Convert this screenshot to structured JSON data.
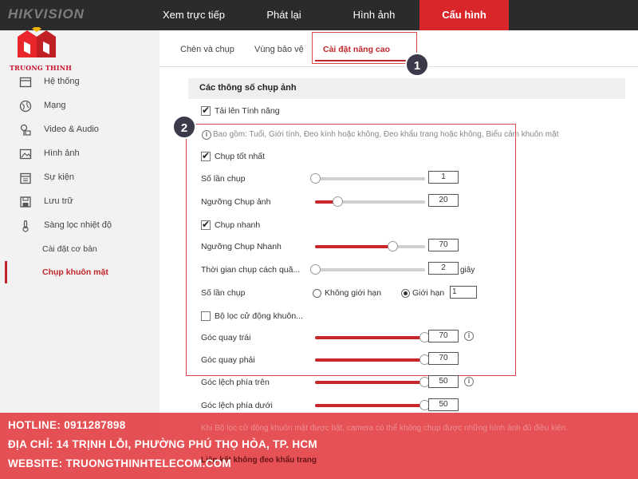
{
  "brand": "HIKVISION",
  "logo_text": "TRUONG THINH",
  "nav": {
    "tabs": [
      {
        "label": "Xem trực tiếp"
      },
      {
        "label": "Phát lại"
      },
      {
        "label": "Hình ảnh"
      },
      {
        "label": "Cấu hình",
        "active": true
      }
    ]
  },
  "sidebar": {
    "items": [
      {
        "label": "Hệ thống",
        "icon": "system-icon"
      },
      {
        "label": "Mạng",
        "icon": "globe-icon"
      },
      {
        "label": "Video & Audio",
        "icon": "video-audio-icon"
      },
      {
        "label": "Hình ảnh",
        "icon": "image-icon"
      },
      {
        "label": "Sự kiện",
        "icon": "calendar-icon"
      },
      {
        "label": "Lưu trữ",
        "icon": "storage-icon"
      },
      {
        "label": "Sàng lọc nhiệt độ",
        "icon": "thermometer-icon"
      }
    ],
    "subitems": [
      {
        "label": "Cài đặt cơ bản"
      },
      {
        "label": "Chụp khuôn mặt",
        "active": true
      }
    ]
  },
  "subtabs": [
    {
      "label": "Chèn và chụp"
    },
    {
      "label": "Vùng bảo vệ"
    },
    {
      "label": "Cài đặt nâng cao",
      "active": true
    }
  ],
  "callouts": [
    "1",
    "2"
  ],
  "section_title": "Các thông số chụp ảnh",
  "upload": {
    "label": "Tải lên Tính năng",
    "checked": true,
    "note": "Bao gồm: Tuổi,  Giới tính,  Đeo kính hoặc không,  Đeo khẩu trang hoặc không,  Biểu cảm khuôn mặt"
  },
  "best_capture": {
    "label": "Chụp tốt nhất",
    "checked": true,
    "count": {
      "label": "Số lần chụp",
      "value": "1",
      "level": 0.0
    },
    "threshold": {
      "label": "Ngưỡng Chụp ảnh",
      "value": "20",
      "level": 0.2
    }
  },
  "quick_capture": {
    "label": "Chụp nhanh",
    "checked": true,
    "threshold": {
      "label": "Ngưỡng Chụp Nhanh",
      "value": "70",
      "level": 0.7
    },
    "interval": {
      "label": "Thời gian chụp cách quã...",
      "value": "2",
      "unit": "giây",
      "level": 0.0
    },
    "count": {
      "label": "Số lần chụp",
      "options": [
        {
          "label": "Không giới hạn",
          "selected": false
        },
        {
          "label": "Giới hạn",
          "selected": true
        }
      ],
      "value": "1"
    }
  },
  "face_filter": {
    "label": "Bộ lọc cử động khuôn...",
    "checked": false,
    "left": {
      "label": "Góc quay trái",
      "value": "70",
      "level": 1.0
    },
    "right": {
      "label": "Góc quay phải",
      "value": "70",
      "level": 1.0
    },
    "up": {
      "label": "Góc lệch phía trên",
      "value": "50",
      "level": 1.0
    },
    "down": {
      "label": "Góc lệch phía dưới",
      "value": "50",
      "level": 1.0
    }
  },
  "warning_note": "Khi Bộ lọc cử động khuôn mặt được bật, camera có thể không chụp được những hình ảnh đủ điều kiện.",
  "mask_link_partial": "Liên kết không đeo khẩu trang",
  "footer": {
    "hotline": "HOTLINE: 0911287898",
    "address": "ĐỊA CHỈ: 14 TRỊNH LỖI, PHƯỜNG PHÚ THỌ HÒA, TP. HCM",
    "website": "WEBSITE: TRUONGTHINHTELECOM.COM"
  },
  "colors": {
    "accent": "#d9262b",
    "topbar": "#2b2b2b",
    "footer": "#e23e42"
  }
}
